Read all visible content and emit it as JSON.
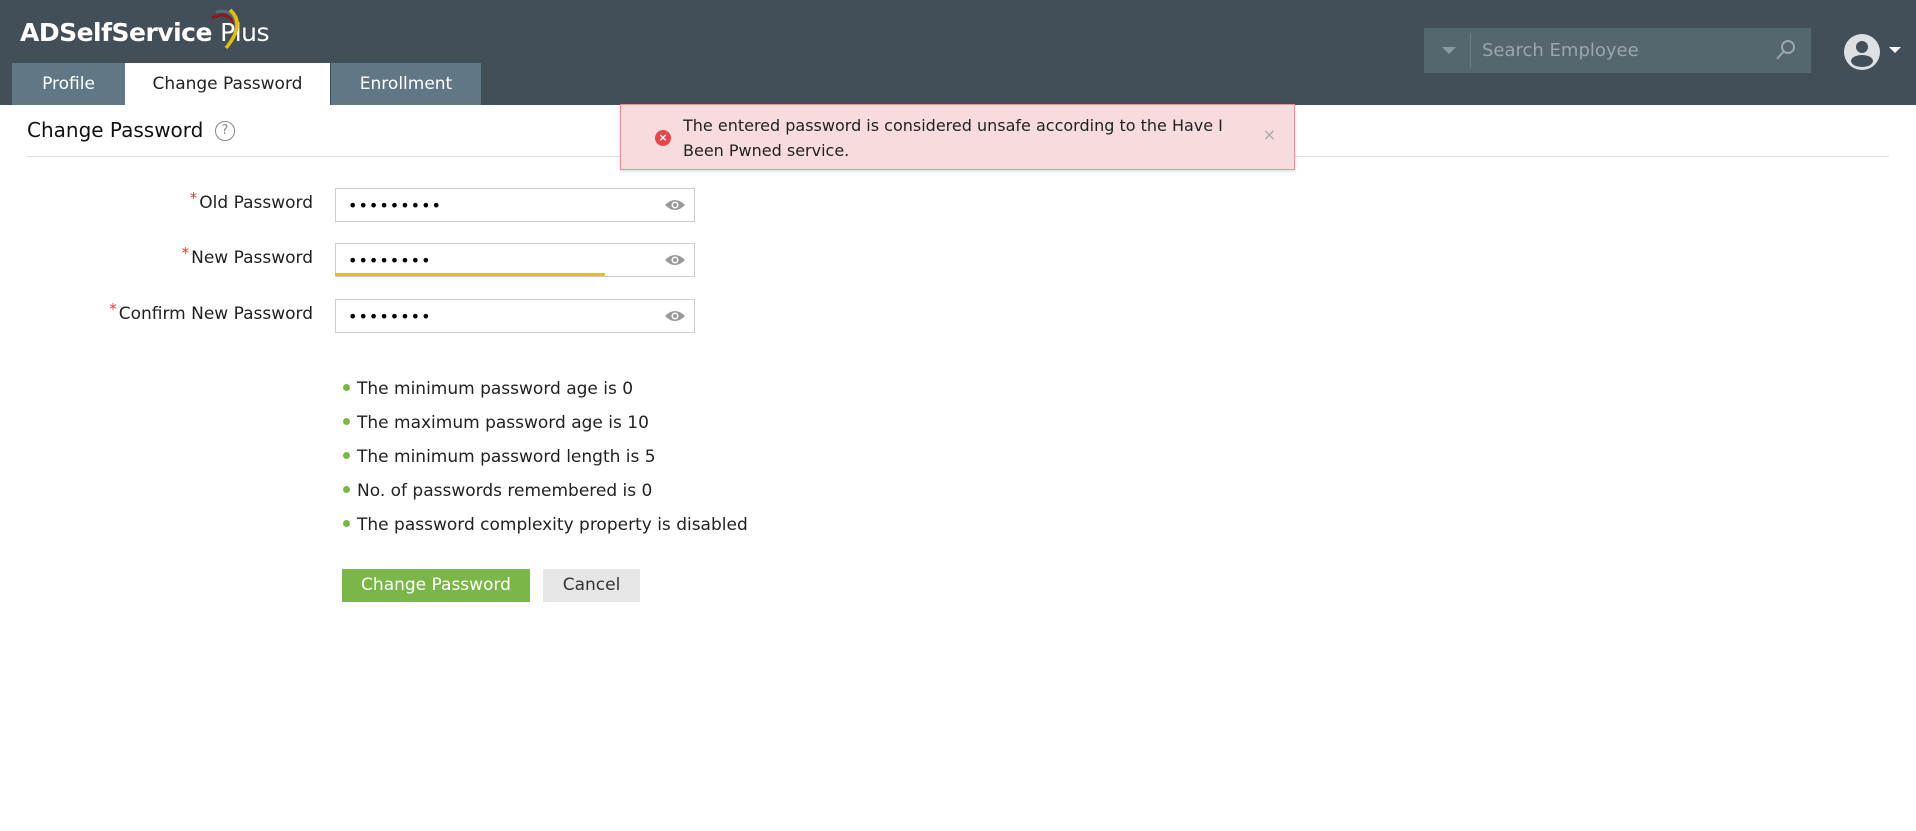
{
  "header": {
    "logo_main": "ADSelfService",
    "logo_plus": "Plus",
    "tabs": [
      {
        "label": "Profile"
      },
      {
        "label": "Change Password"
      },
      {
        "label": "Enrollment"
      }
    ],
    "search": {
      "placeholder": "Search Employee"
    }
  },
  "page": {
    "title": "Change Password"
  },
  "toast": {
    "message": "The entered password is considered unsafe according to the Have I Been Pwned service.",
    "close": "×",
    "type": "error"
  },
  "form": {
    "fields": [
      {
        "label": "Old Password",
        "value": "•••••••••",
        "required": "*"
      },
      {
        "label": "New Password",
        "value": "••••••••",
        "required": "*",
        "strength": 0.75
      },
      {
        "label": "Confirm New Password",
        "value": "••••••••",
        "required": "*"
      }
    ],
    "rules": [
      "The minimum password age is 0",
      "The maximum password age is 10",
      "The minimum password length is 5",
      "No. of passwords remembered is 0",
      "The password complexity property is disabled"
    ],
    "submit_label": "Change Password",
    "cancel_label": "Cancel"
  },
  "colors": {
    "header": "#434f58",
    "tab": "#607785",
    "primary": "#7ab648",
    "error": "#e5474d",
    "strength": "#e0c800"
  }
}
